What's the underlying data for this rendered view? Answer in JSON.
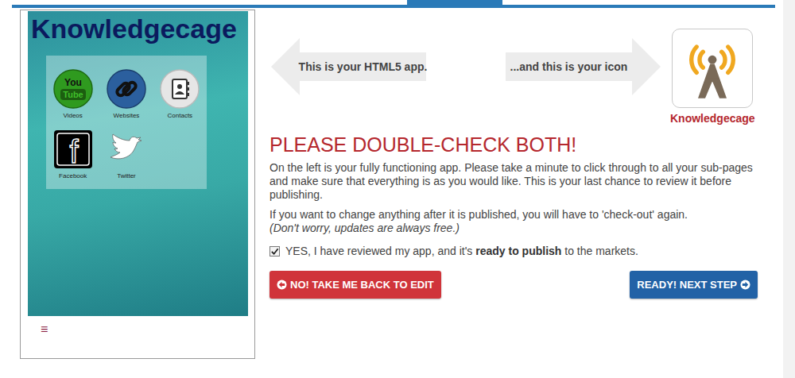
{
  "app_preview": {
    "title": "Knowledgecage",
    "apps": [
      {
        "label": "Videos",
        "kind": "youtube",
        "icon_text": [
          "You",
          "Tube"
        ]
      },
      {
        "label": "Websites",
        "kind": "link",
        "icon_text": []
      },
      {
        "label": "Contacts",
        "kind": "contacts",
        "icon_text": []
      },
      {
        "label": "Facebook",
        "kind": "facebook",
        "icon_text": [
          "f"
        ]
      },
      {
        "label": "Twitter",
        "kind": "twitter",
        "icon_text": []
      }
    ],
    "menu_icon": "≡"
  },
  "callouts": [
    {
      "text": "This is your HTML5 app.",
      "kind": "left"
    },
    {
      "text": "...and this is your icon",
      "kind": "right"
    }
  ],
  "app_icon": {
    "label": "Knowledgecage"
  },
  "heading": "PLEASE DOUBLE-CHECK BOTH!",
  "paragraphs": [
    {
      "text": "On the left is your fully functioning app. Please take a minute to click through to all your sub-pages and make sure that everything is as you would like. This is your last chance to review it before publishing.",
      "note": ""
    },
    {
      "text": "If you want to change anything after it is published, you will have to 'check-out' again.",
      "note": "(Don't worry, updates are always free.)"
    }
  ],
  "confirm": {
    "checked": true,
    "text_before": "YES, I have reviewed my app, and it's ",
    "bold": "ready to publish",
    "text_after": " to the markets."
  },
  "buttons": [
    {
      "label": "NO! TAKE ME BACK TO EDIT",
      "kind": "back"
    },
    {
      "label": "READY! NEXT STEP",
      "kind": "next"
    }
  ]
}
